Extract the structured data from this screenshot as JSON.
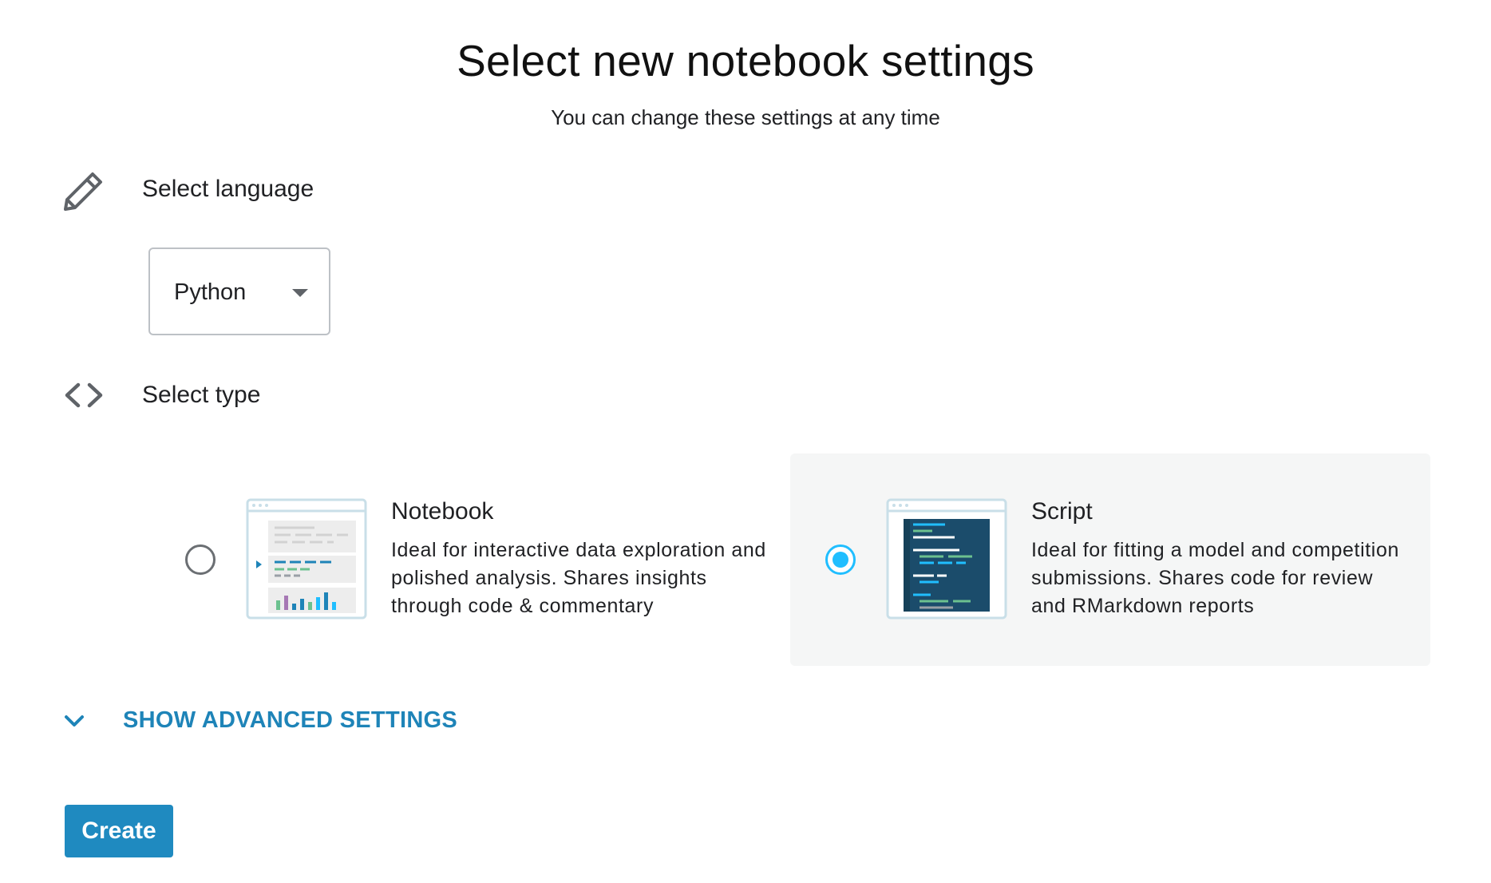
{
  "header": {
    "title": "Select new notebook settings",
    "subtitle": "You can change these settings at any time"
  },
  "language": {
    "icon": "pencil-icon",
    "label": "Select language",
    "selected": "Python"
  },
  "type": {
    "icon": "code-brackets-icon",
    "label": "Select type",
    "options": [
      {
        "title": "Notebook",
        "description": "Ideal for interactive data exploration and polished analysis. Shares insights through code & commentary",
        "selected": false
      },
      {
        "title": "Script",
        "description": "Ideal for fitting a model and competition submissions. Shares code for review and RMarkdown reports",
        "selected": true
      }
    ]
  },
  "advanced": {
    "icon": "chevron-down-icon",
    "label": "SHOW ADVANCED SETTINGS"
  },
  "actions": {
    "create_label": "Create"
  },
  "colors": {
    "accent": "#1f8ac0",
    "link": "#1e84b8",
    "radio_selected": "#20beff",
    "selected_card_bg": "#f5f6f6"
  }
}
